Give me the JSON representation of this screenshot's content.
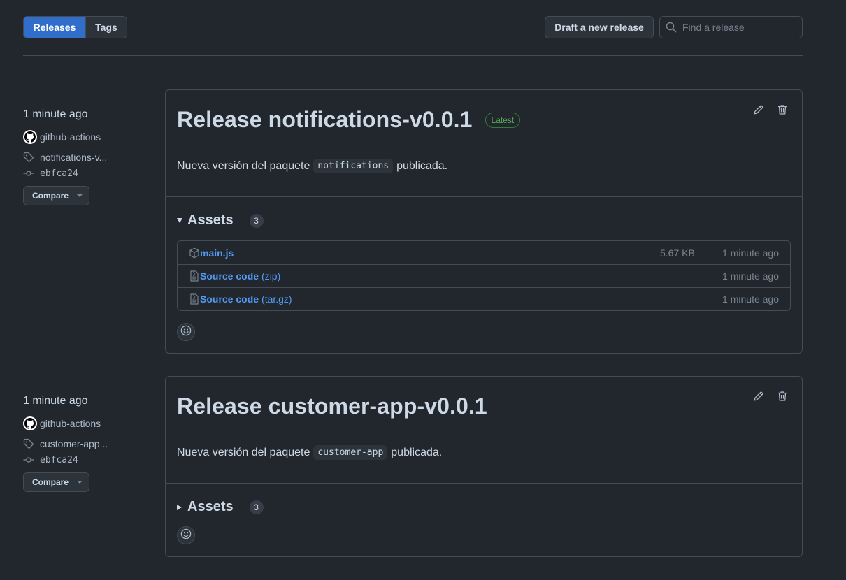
{
  "nav": {
    "tabs": [
      {
        "label": "Releases",
        "active": true
      },
      {
        "label": "Tags",
        "active": false
      }
    ],
    "draft_button": "Draft a new release",
    "search_placeholder": "Find a release"
  },
  "colors": {
    "accent": "#316dca",
    "link": "#539bf5",
    "latest_green": "#57ab5a",
    "background": "#22272e"
  },
  "releases": [
    {
      "time": "1 minute ago",
      "author": "github-actions",
      "tag": "notifications-v...",
      "commit": "ebfca24",
      "compare_label": "Compare",
      "title": "Release notifications-v0.0.1",
      "latest_badge": "Latest",
      "body_prefix": "Nueva versión del paquete",
      "body_code": "notifications",
      "body_suffix": "publicada.",
      "assets_label": "Assets",
      "assets_count": "3",
      "assets_expanded": true,
      "assets": [
        {
          "name": "main.js",
          "sub": "",
          "size": "5.67 KB",
          "time": "1 minute ago",
          "icon": "package-icon"
        },
        {
          "name": "Source code",
          "sub": "(zip)",
          "size": "",
          "time": "1 minute ago",
          "icon": "file-zip-icon"
        },
        {
          "name": "Source code",
          "sub": "(tar.gz)",
          "size": "",
          "time": "1 minute ago",
          "icon": "file-zip-icon"
        }
      ]
    },
    {
      "time": "1 minute ago",
      "author": "github-actions",
      "tag": "customer-app...",
      "commit": "ebfca24",
      "compare_label": "Compare",
      "title": "Release customer-app-v0.0.1",
      "latest_badge": "",
      "body_prefix": "Nueva versión del paquete",
      "body_code": "customer-app",
      "body_suffix": "publicada.",
      "assets_label": "Assets",
      "assets_count": "3",
      "assets_expanded": false,
      "assets": []
    }
  ]
}
